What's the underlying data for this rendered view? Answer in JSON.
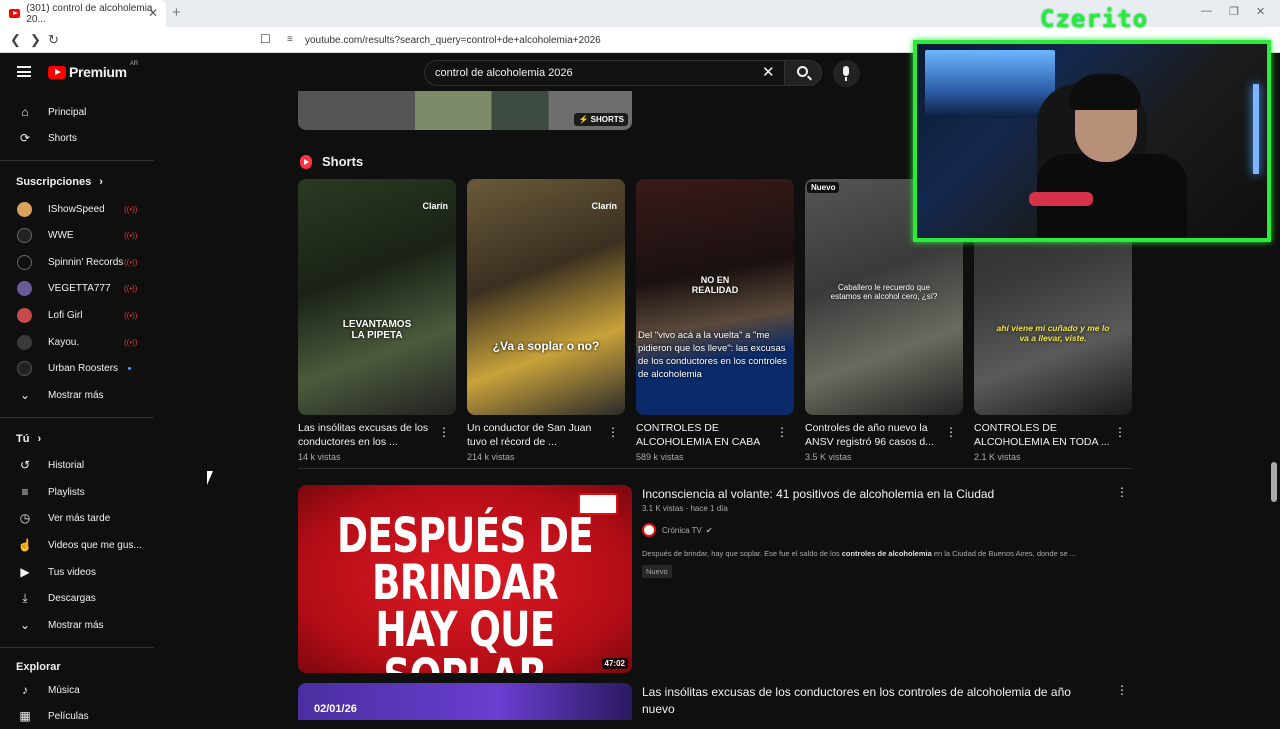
{
  "browser": {
    "tab_title": "(301) control de alcoholemia 20...",
    "url": "youtube.com/results?search_query=control+de+alcoholemia+2026",
    "tab_close": "✕",
    "new_tab": "+"
  },
  "header": {
    "brand": "Premium",
    "country": "AR",
    "search_value": "control de alcoholemia 2026",
    "clear": "✕"
  },
  "sidebar": {
    "main": [
      {
        "label": "Principal",
        "icon": "home-icon"
      },
      {
        "label": "Shorts",
        "icon": "shorts-icon"
      }
    ],
    "subscriptions_heading": "Suscripciones",
    "subscriptions": [
      {
        "label": "IShowSpeed",
        "color": "#d9a35b",
        "live": true
      },
      {
        "label": "WWE",
        "color": "#222222",
        "live": true
      },
      {
        "label": "Spinnin' Records",
        "color": "#111111",
        "live": true
      },
      {
        "label": "VEGETTA777",
        "color": "#6a5a9a",
        "live": true
      },
      {
        "label": "Lofi Girl",
        "color": "#c44b4b",
        "live": true
      },
      {
        "label": "Kayou.",
        "color": "#3a3a3a",
        "live": true
      },
      {
        "label": "Urban Roosters",
        "color": "#222222",
        "live": false
      }
    ],
    "show_more": "Mostrar más",
    "you_heading": "Tú",
    "you_items": [
      {
        "label": "Historial",
        "icon": "history-icon"
      },
      {
        "label": "Playlists",
        "icon": "playlists-icon"
      },
      {
        "label": "Ver más tarde",
        "icon": "watch-later-icon"
      },
      {
        "label": "Videos que me gus...",
        "icon": "liked-icon"
      },
      {
        "label": "Tus videos",
        "icon": "your-videos-icon"
      },
      {
        "label": "Descargas",
        "icon": "downloads-icon"
      }
    ],
    "show_more_2": "Mostrar más",
    "explore_heading": "Explorar",
    "explore_items": [
      {
        "label": "Música",
        "icon": "music-icon"
      },
      {
        "label": "Películas",
        "icon": "movies-icon"
      }
    ]
  },
  "main": {
    "top_badge": "SHORTS",
    "shorts_heading": "Shorts",
    "shorts": [
      {
        "title": "Las insólitas excusas de los conductores en los ...",
        "views": "14 k vistas",
        "overlay": "LEVANTAMOS LA PIPETA",
        "brand": "Clarín",
        "bg": "linear-gradient(160deg,#2a3a22,#1a2216 40%,#4b5a3c 70%,#222)"
      },
      {
        "title": "Un conductor de San Juan tuvo el récord de ...",
        "views": "214 k vistas",
        "overlay": "¿Va a soplar o no?",
        "brand": "Clarín",
        "bg": "linear-gradient(160deg,#6b5a3a,#3a3020 40%,#c9a23a 70%,#2a2a2a)"
      },
      {
        "title": "CONTROLES DE ALCOHOLEMIA EN CABA I...",
        "views": "589 k vistas",
        "overlay": "NO EN REALIDAD",
        "caption": "Del \"vivo acá a la vuelta\" a \"me pidieron que los lleve\": las excusas de los conductores en los controles de alcoholemia",
        "bg": "linear-gradient(170deg,#3a1a1a,#1a1010 40%,#5a4a3a 60%,#0a2a6a 75%)"
      },
      {
        "title": "Controles de año nuevo la ANSV registró 96 casos d...",
        "views": "3.5 K vistas",
        "overlay": "Caballero le recuerdo que estamos en alcohol cero, ¿sí?",
        "badge": "Nuevo",
        "bg": "linear-gradient(160deg,#555,#3a3a3a 40%,#6a6a60 70%,#222)"
      },
      {
        "title": "CONTROLES DE ALCOHOLEMIA EN TODA ...",
        "views": "2.1 K vistas",
        "overlay": "ahí viene mi cuñado y me lo va a llevar, viste.",
        "bg": "linear-gradient(160deg,#2a2a2a,#3a3a3a 40%,#5a5a5a 70%,#1a1a1a)"
      }
    ],
    "videos": [
      {
        "title": "Inconsciencia al volante: 41 positivos de alcoholemia en la Ciudad",
        "meta": "3.1 K vistas · hace 1 día",
        "channel": "Crónica TV",
        "desc_pre": "Después de brindar, hay que soplar. Ese fue el saldo de los ",
        "desc_bold": "controles de alcoholemia",
        "desc_post": " en la Ciudad de Buenos Aires, donde se ...",
        "badge": "Nuevo",
        "thumb_text": "DESPUÉS DE BRINDAR HAY QUE SOPLAR",
        "duration": "47:02",
        "thumb_color": "#c8101a"
      },
      {
        "title": "Las insólitas excusas de los conductores en los controles de alcoholemia de año nuevo",
        "thumb_date": "02/01/26",
        "thumb_color": "#5a2ea8"
      }
    ]
  },
  "overlay": {
    "streamer_name": "Czerito"
  }
}
